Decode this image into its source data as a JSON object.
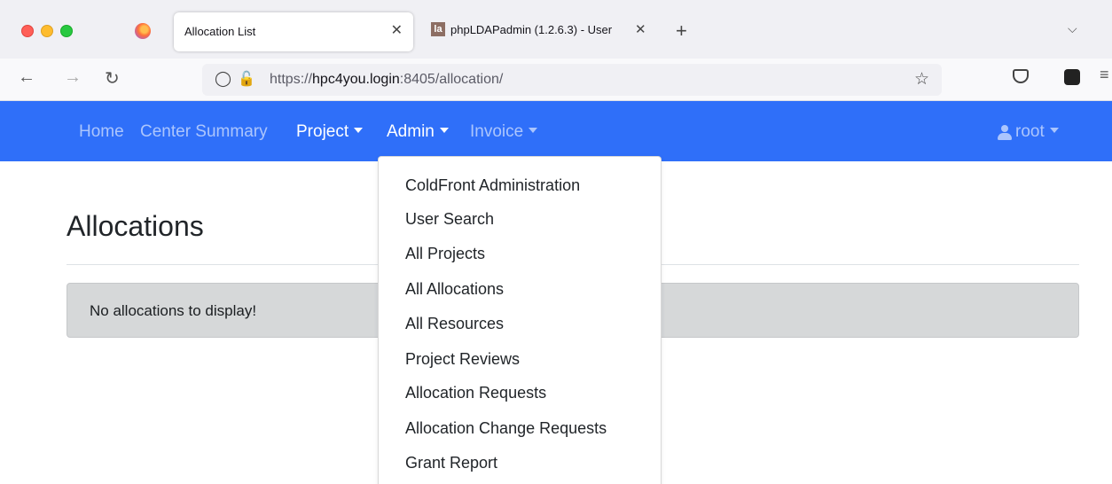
{
  "browser": {
    "active_tab": {
      "title": "Allocation List",
      "close": "✕"
    },
    "inactive_tab": {
      "title": "phpLDAPadmin (1.2.6.3) - User",
      "close": "✕"
    },
    "new_tab": "+",
    "tab_list": "⌵",
    "url_prefix": "https://",
    "url_host": "hpc4you.login",
    "url_rest": ":8405/allocation/"
  },
  "navbar": {
    "home": "Home",
    "center_summary": "Center Summary",
    "project": "Project",
    "admin": "Admin",
    "invoice": "Invoice",
    "user": "root"
  },
  "page": {
    "title": "Allocations",
    "alert": "No allocations to display!"
  },
  "admin_menu": {
    "items": [
      "ColdFront Administration",
      "User Search",
      "All Projects",
      "All Allocations",
      "All Resources",
      "Project Reviews",
      "Allocation Requests",
      "Allocation Change Requests",
      "Grant Report"
    ]
  },
  "colors": {
    "navbar_bg": "#2f6ff9",
    "alert_bg": "#d6d8d9"
  }
}
